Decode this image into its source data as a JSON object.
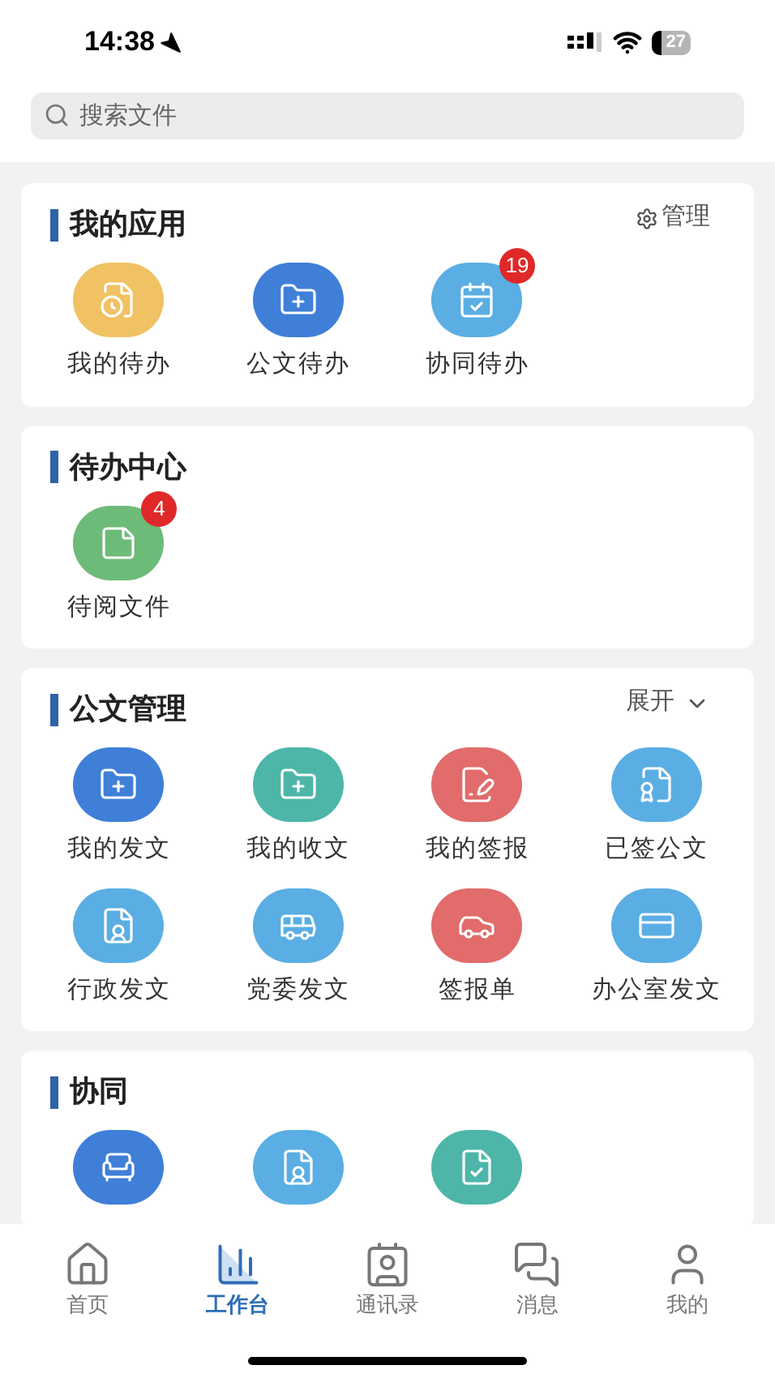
{
  "status_bar": {
    "time": "14:38",
    "battery": "27"
  },
  "search": {
    "placeholder": "搜索文件"
  },
  "sections": [
    {
      "title": "我的应用",
      "action": {
        "kind": "manage",
        "label": "管理"
      },
      "items": [
        {
          "label": "我的待办",
          "color": "#f0c263"
        },
        {
          "label": "公文待办",
          "color": "#3f7fd8"
        },
        {
          "label": "协同待办",
          "color": "#5aaee3",
          "badge": "19"
        }
      ]
    },
    {
      "title": "待办中心",
      "items": [
        {
          "label": "待阅文件",
          "color": "#6dbb78",
          "badge": "4"
        }
      ]
    },
    {
      "title": "公文管理",
      "action": {
        "kind": "expand",
        "label": "展开"
      },
      "items": [
        {
          "label": "我的发文",
          "color": "#3f7fd8"
        },
        {
          "label": "我的收文",
          "color": "#4db6a8"
        },
        {
          "label": "我的签报",
          "color": "#e26b6b"
        },
        {
          "label": "已签公文",
          "color": "#5aaee3"
        },
        {
          "label": "行政发文",
          "color": "#5aaee3"
        },
        {
          "label": "党委发文",
          "color": "#5aaee3"
        },
        {
          "label": "签报单",
          "color": "#e26b6b"
        },
        {
          "label": "办公室发文",
          "color": "#5aaee3"
        }
      ]
    },
    {
      "title": "协同",
      "items": [
        {
          "color": "#3f7fd8"
        },
        {
          "color": "#5aaee3"
        },
        {
          "color": "#4db6a8"
        }
      ]
    }
  ],
  "tabs": [
    {
      "label": "首页",
      "selected": false
    },
    {
      "label": "工作台",
      "selected": true
    },
    {
      "label": "通讯录",
      "selected": false
    },
    {
      "label": "消息",
      "selected": false
    },
    {
      "label": "我的",
      "selected": false
    }
  ]
}
